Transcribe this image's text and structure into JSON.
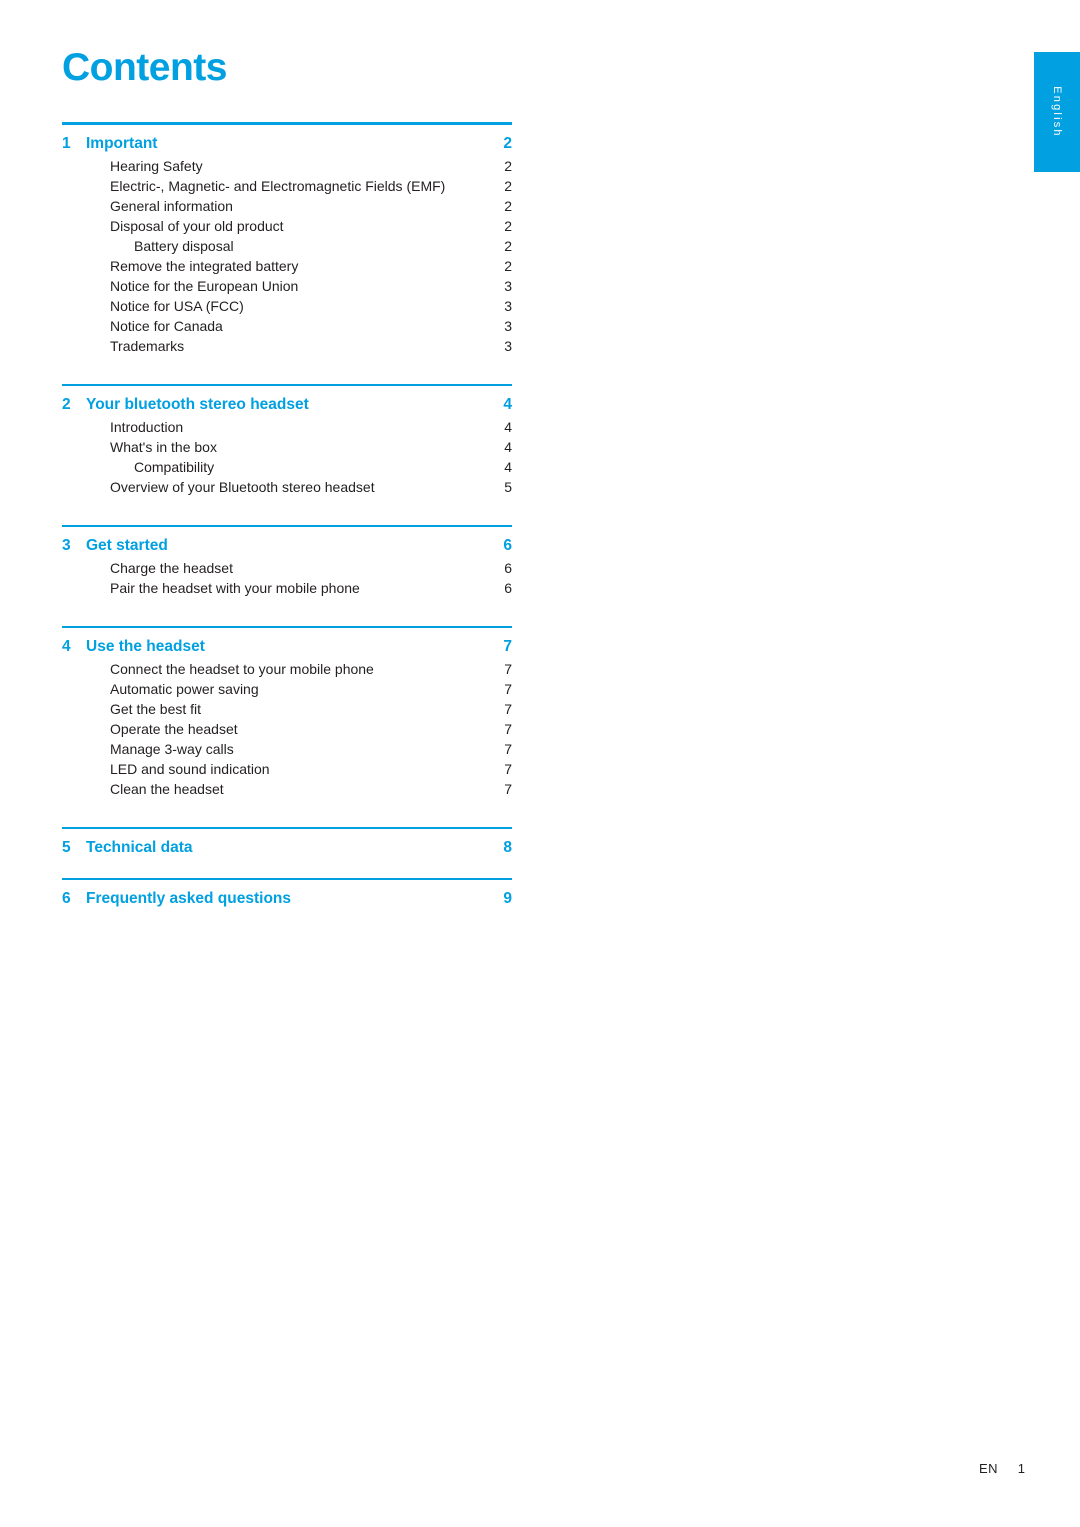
{
  "side_tab": {
    "label": "English",
    "color": "#00a0e1"
  },
  "title": "Contents",
  "accent_color": "#00a0e1",
  "text_color": "#231f20",
  "toc": {
    "groups": [
      {
        "chapter": {
          "num": "1",
          "label": "Important",
          "page": "2"
        },
        "items": [
          {
            "label": "Hearing Safety",
            "page": "2",
            "level": 1
          },
          {
            "label": "Electric-, Magnetic- and Electromagnetic Fields (EMF)",
            "page": "2",
            "level": 1
          },
          {
            "label": "General information",
            "page": "2",
            "level": 1
          },
          {
            "label": "Disposal of your old product",
            "page": "2",
            "level": 1
          },
          {
            "label": "Battery disposal",
            "page": "2",
            "level": 2
          },
          {
            "label": "Remove the integrated battery",
            "page": "2",
            "level": 1
          },
          {
            "label": "Notice for the European Union",
            "page": "3",
            "level": 1
          },
          {
            "label": "Notice for USA (FCC)",
            "page": "3",
            "level": 1
          },
          {
            "label": "Notice for Canada",
            "page": "3",
            "level": 1
          },
          {
            "label": "Trademarks",
            "page": "3",
            "level": 1
          }
        ]
      },
      {
        "chapter": {
          "num": "2",
          "label": "Your bluetooth stereo headset",
          "page": "4"
        },
        "items": [
          {
            "label": "Introduction",
            "page": "4",
            "level": 1
          },
          {
            "label": "What's in the box",
            "page": "4",
            "level": 1
          },
          {
            "label": "Compatibility",
            "page": "4",
            "level": 2
          },
          {
            "label": "Overview of your Bluetooth stereo headset",
            "page": "5",
            "level": 1
          }
        ]
      },
      {
        "chapter": {
          "num": "3",
          "label": "Get started",
          "page": "6"
        },
        "items": [
          {
            "label": "Charge the headset",
            "page": "6",
            "level": 1
          },
          {
            "label": "Pair the headset with your mobile phone",
            "page": "6",
            "level": 1
          }
        ]
      },
      {
        "chapter": {
          "num": "4",
          "label": "Use the headset",
          "page": "7"
        },
        "items": [
          {
            "label": "Connect the headset to your mobile phone",
            "page": "7",
            "level": 1
          },
          {
            "label": "Automatic power saving",
            "page": "7",
            "level": 1
          },
          {
            "label": "Get the best fit",
            "page": "7",
            "level": 1
          },
          {
            "label": "Operate the headset",
            "page": "7",
            "level": 1
          },
          {
            "label": "Manage 3-way calls",
            "page": "7",
            "level": 1
          },
          {
            "label": "LED and sound indication",
            "page": "7",
            "level": 1
          },
          {
            "label": "Clean the headset",
            "page": "7",
            "level": 1
          }
        ]
      },
      {
        "chapter": {
          "num": "5",
          "label": "Technical data",
          "page": "8"
        },
        "items": []
      },
      {
        "chapter": {
          "num": "6",
          "label": "Frequently asked questions",
          "page": "9"
        },
        "items": []
      }
    ]
  },
  "footer": {
    "lang": "EN",
    "page": "1"
  }
}
